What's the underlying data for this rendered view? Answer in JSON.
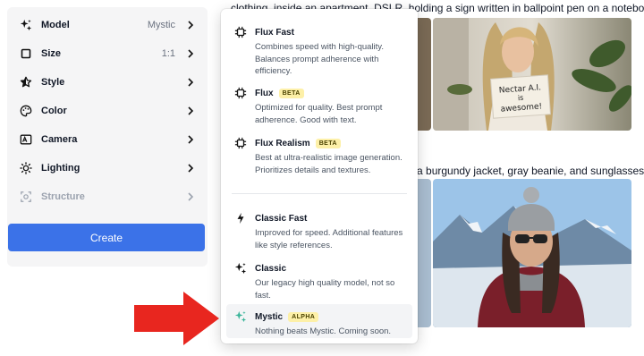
{
  "settings": [
    {
      "label": "Model",
      "value": "Mystic",
      "icon": "sparkles-icon"
    },
    {
      "label": "Size",
      "value": "1:1",
      "icon": "square-icon"
    },
    {
      "label": "Style",
      "value": "",
      "icon": "star-icon"
    },
    {
      "label": "Color",
      "value": "",
      "icon": "palette-icon"
    },
    {
      "label": "Camera",
      "value": "",
      "icon": "camera-frame-icon"
    },
    {
      "label": "Lighting",
      "value": "",
      "icon": "sun-icon"
    },
    {
      "label": "Structure",
      "value": "",
      "icon": "structure-icon"
    }
  ],
  "create_label": "Create",
  "content": {
    "prompt1": "clothing, inside an apartment, DSLR, holding a sign written in ballpoint pen on a notebook saying",
    "prompt2": "g a burgundy jacket, gray beanie, and sunglasses,",
    "sign_line1": "Nectar A.I.",
    "sign_line2": "is",
    "sign_line3": "awesome!"
  },
  "dropdown": {
    "options": [
      {
        "title": "Flux Fast",
        "badge": "",
        "desc": "Combines speed with high-quality. Balances prompt adherence with efficiency.",
        "icon": "chip-icon"
      },
      {
        "title": "Flux",
        "badge": "BETA",
        "desc": "Optimized for quality. Best prompt adherence. Good with text.",
        "icon": "chip-icon"
      },
      {
        "title": "Flux Realism",
        "badge": "BETA",
        "desc": "Best at ultra-realistic image generation. Prioritizes details and textures.",
        "icon": "chip-icon"
      },
      {
        "title": "Classic Fast",
        "badge": "",
        "desc": "Improved for speed. Additional features like style references.",
        "icon": "lightning-icon"
      },
      {
        "title": "Classic",
        "badge": "",
        "desc": "Our legacy high quality model, not so fast.",
        "icon": "sparkles-icon"
      },
      {
        "title": "Mystic",
        "badge": "ALPHA",
        "desc": "Nothing beats Mystic. Coming soon.",
        "icon": "sparkles-green-icon"
      }
    ]
  },
  "colors": {
    "accent": "#3b72e8",
    "arrow": "#e8261f",
    "badge_bg": "#fdf0a8",
    "mystic_icon": "#3bb59a"
  }
}
